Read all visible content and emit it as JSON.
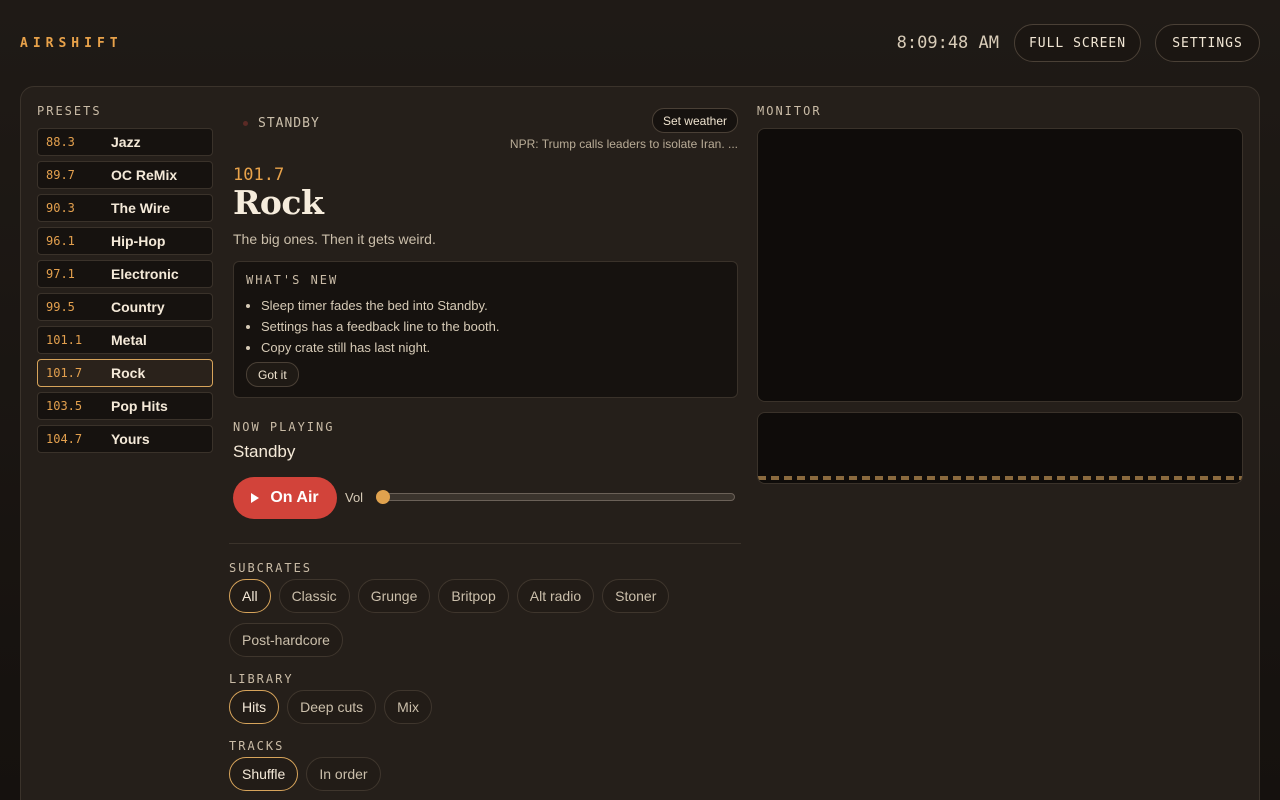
{
  "header": {
    "brand": "AIRSHIFT",
    "clock": "8:09:48 AM",
    "full_screen_label": "FULL SCREEN",
    "settings_label": "SETTINGS"
  },
  "presets": {
    "label": "PRESETS",
    "items": [
      {
        "freq": "88.3",
        "name": "Jazz",
        "active": false
      },
      {
        "freq": "89.7",
        "name": "OC ReMix",
        "active": false
      },
      {
        "freq": "90.3",
        "name": "The Wire",
        "active": false
      },
      {
        "freq": "96.1",
        "name": "Hip-Hop",
        "active": false
      },
      {
        "freq": "97.1",
        "name": "Electronic",
        "active": false
      },
      {
        "freq": "99.5",
        "name": "Country",
        "active": false
      },
      {
        "freq": "101.1",
        "name": "Metal",
        "active": false
      },
      {
        "freq": "101.7",
        "name": "Rock",
        "active": true
      },
      {
        "freq": "103.5",
        "name": "Pop Hits",
        "active": false
      },
      {
        "freq": "104.7",
        "name": "Yours",
        "active": false
      }
    ]
  },
  "station": {
    "status": "STANDBY",
    "weather_button": "Set weather",
    "news": "NPR: Trump calls leaders to isolate Iran. ...",
    "frequency": "101.7",
    "name": "Rock",
    "tagline": "The big ones. Then it gets weird."
  },
  "whats_new": {
    "label": "WHAT'S NEW",
    "items": [
      "Sleep timer fades the bed into Standby.",
      "Settings has a feedback line to the booth.",
      "Copy crate still has last night."
    ],
    "dismiss_label": "Got it"
  },
  "now_playing": {
    "label": "NOW PLAYING",
    "title": "Standby",
    "on_air_label": "On Air",
    "volume_label": "Vol",
    "volume": 0
  },
  "subcrates": {
    "label": "SUBCRATES",
    "options": [
      "All",
      "Classic",
      "Grunge",
      "Britpop",
      "Alt radio",
      "Stoner",
      "Post-hardcore"
    ],
    "selected": "All"
  },
  "library": {
    "label": "LIBRARY",
    "options": [
      "Hits",
      "Deep cuts",
      "Mix"
    ],
    "selected": "Hits"
  },
  "tracks": {
    "label": "TRACKS",
    "options": [
      "Shuffle",
      "In order"
    ],
    "selected": "Shuffle"
  },
  "monitor": {
    "label": "MONITOR"
  },
  "colors": {
    "accent": "#e8a24a",
    "on_air": "#d2433a",
    "background": "#1b1612"
  },
  "icons": {
    "on_air": "play-icon",
    "status": "status-dot-icon"
  }
}
